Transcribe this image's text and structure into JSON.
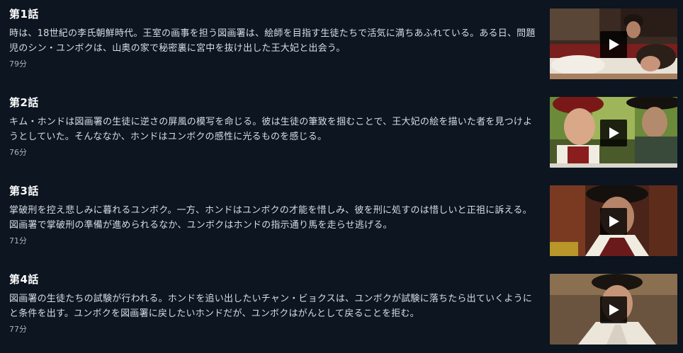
{
  "episodes": [
    {
      "title": "第1話",
      "description": "時は、18世紀の李氏朝鮮時代。王室の画事を担う図画署は、絵師を目指す生徒たちで活気に満ちあふれている。ある日、問題児のシン・ユンボクは、山奥の家で秘密裏に宮中を抜け出した王大妃と出会う。",
      "duration": "79分",
      "play_icon": "play-icon"
    },
    {
      "title": "第2話",
      "description": "キム・ホンドは図画署の生徒に逆さの屏風の模写を命じる。彼は生徒の筆致を掴むことで、王大妃の絵を描いた者を見つけようとしていた。そんななか、ホンドはユンボクの感性に光るものを感じる。",
      "duration": "76分",
      "play_icon": "play-icon"
    },
    {
      "title": "第3話",
      "description": "掌破刑を控え悲しみに暮れるユンボク。一方、ホンドはユンボクの才能を惜しみ、彼を刑に処すのは惜しいと正祖に訴える。図画署で掌破刑の準備が進められるなか、ユンボクはホンドの指示通り馬を走らせ逃げる。",
      "duration": "71分",
      "play_icon": "play-icon"
    },
    {
      "title": "第4話",
      "description": "図画署の生徒たちの試験が行われる。ホンドを追い出したいチャン・ビョクスは、ユンボクが試験に落ちたら出ていくようにと条件を出す。ユンボクを図画署に戻したいホンドだが、ユンボクはがんとして戻ることを拒む。",
      "duration": "77分",
      "play_icon": "play-icon"
    }
  ],
  "colors": {
    "background": "#0c1520",
    "title": "#ffffff",
    "description": "#d6dde4",
    "duration": "#aab3bc"
  }
}
